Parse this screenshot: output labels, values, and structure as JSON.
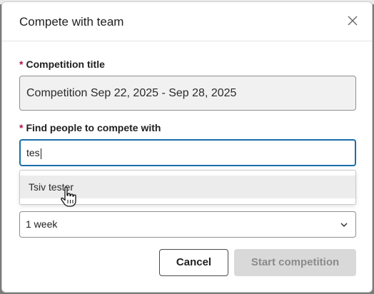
{
  "dialog": {
    "title": "Compete with team"
  },
  "form": {
    "required_marker": "*",
    "competition_title": {
      "label": "Competition title",
      "value": "Competition Sep 22, 2025 - Sep 28, 2025"
    },
    "find_people": {
      "label": "Find people to compete with",
      "value": "tes",
      "suggestions": [
        "Tsiv tester"
      ]
    },
    "duration": {
      "selected": "1 week"
    }
  },
  "actions": {
    "cancel_label": "Cancel",
    "start_label": "Start competition"
  },
  "icons": {
    "close": "close-icon",
    "chevron": "chevron-down-icon",
    "cursor": "hand-pointer-cursor"
  },
  "colors": {
    "required": "#b3124a",
    "focus_border": "#1a6ea8",
    "disabled_button": "#d9d9d9"
  }
}
